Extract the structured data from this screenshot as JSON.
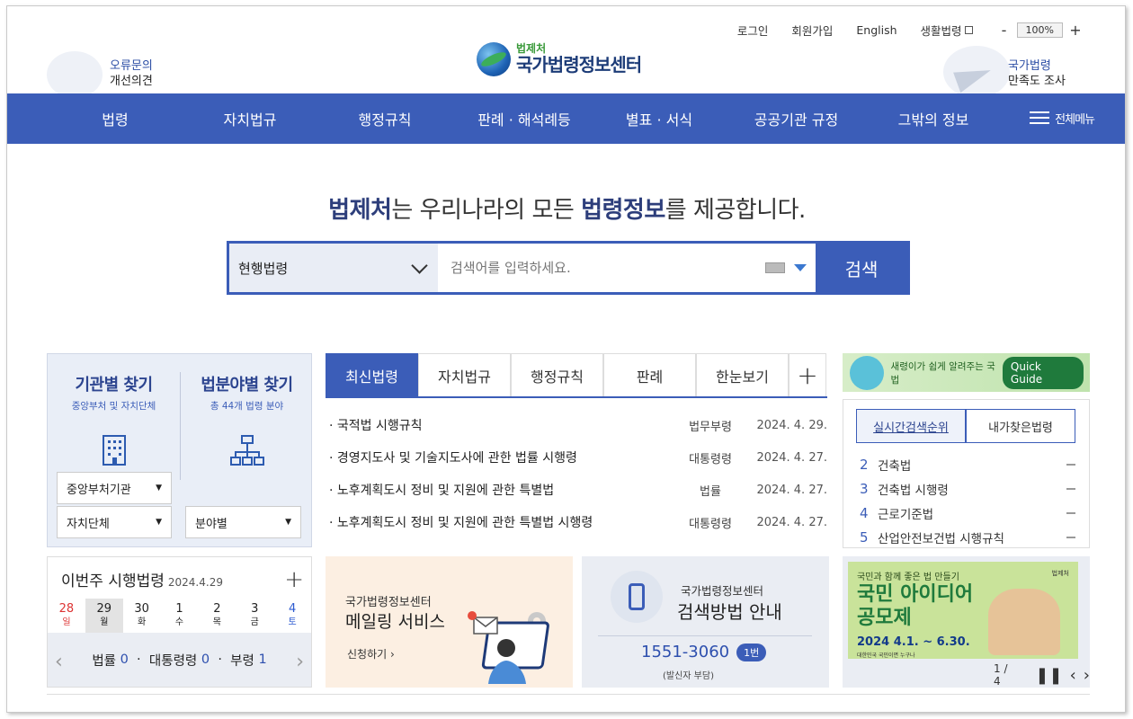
{
  "util": {
    "login": "로그인",
    "signup": "회원가입",
    "english": "English",
    "life_law": "생활법령",
    "zoom_minus": "-",
    "zoom_value": "100%",
    "zoom_plus": "+"
  },
  "left_banner": {
    "line1": "오류문의",
    "line2": "개선의견"
  },
  "logo": {
    "small": "법제처",
    "big": "국가법령정보센터"
  },
  "right_banner": {
    "line1": "국가법령",
    "line2": "만족도 조사"
  },
  "gnb": {
    "items": [
      "법령",
      "자치법규",
      "행정규칙",
      "판례 · 해석례등",
      "별표 · 서식",
      "공공기관 규정",
      "그밖의 정보"
    ],
    "all_menu": "전체메뉴"
  },
  "headline": {
    "p1": "법제처",
    "p2": "는 우리나라의 모든 ",
    "p3": "법령정보",
    "p4": "를 제공합니다."
  },
  "search": {
    "select": "현행법령",
    "placeholder": "검색어를 입력하세요.",
    "button": "검색"
  },
  "finder": {
    "org": {
      "title": "기관별 찾기",
      "sub": "중앙부처 및 자치단체",
      "dd1": "중앙부처기관",
      "dd2": "자치단체"
    },
    "field": {
      "title": "법분야별 찾기",
      "sub": "총 44개 법령 분야",
      "dd1": "분야별"
    }
  },
  "week": {
    "title": "이번주 시행법령",
    "date": "2024.4.29",
    "plus": "+",
    "days": [
      {
        "n": "28",
        "w": "일"
      },
      {
        "n": "29",
        "w": "월"
      },
      {
        "n": "30",
        "w": "화"
      },
      {
        "n": "1",
        "w": "수"
      },
      {
        "n": "2",
        "w": "목"
      },
      {
        "n": "3",
        "w": "금"
      },
      {
        "n": "4",
        "w": "토"
      }
    ],
    "law_label": "법률",
    "law_count": "0",
    "decree_label": "대통령령",
    "decree_count": "0",
    "ordinance_label": "부령",
    "ordinance_count": "1",
    "prev": "‹",
    "next": "›"
  },
  "tabs": {
    "items": [
      "최신법령",
      "자치법규",
      "행정규칙",
      "판례",
      "한눈보기"
    ],
    "more": "+"
  },
  "latest": [
    {
      "title": "· 국적법 시행규칙",
      "kind": "법무부령",
      "date": "2024. 4. 29."
    },
    {
      "title": "· 경영지도사 및 기술지도사에 관한 법률 시행령",
      "kind": "대통령령",
      "date": "2024. 4. 27."
    },
    {
      "title": "· 노후계획도시 정비 및 지원에 관한 특별법",
      "kind": "법률",
      "date": "2024. 4. 27."
    },
    {
      "title": "· 노후계획도시 정비 및 지원에 관한 특별법 시행령",
      "kind": "대통령령",
      "date": "2024. 4. 27."
    }
  ],
  "mail": {
    "line1": "국가법령정보센터",
    "line2": "메일링 서비스",
    "apply": "신청하기 ›"
  },
  "guide": {
    "line1": "국가법령정보센터",
    "line2": "검색방법 안내",
    "phone": "1551-3060",
    "ext": "1번",
    "note": "(발신자 부담)"
  },
  "quick": {
    "text": "새령이가 쉽게 알려주는 국법",
    "button": "Quick Guide"
  },
  "rank": {
    "tab1": "실시간검색순위",
    "tab2": "내가찾은법령",
    "items": [
      {
        "n": "2",
        "name": "건축법"
      },
      {
        "n": "3",
        "name": "건축법 시행령"
      },
      {
        "n": "4",
        "name": "근로기준법"
      },
      {
        "n": "5",
        "name": "산업안전보건법 시행규칙"
      }
    ]
  },
  "idea": {
    "top": "국민과 함께 좋은 법 만들기",
    "title1": "국민 아이디어",
    "title2": "공모제",
    "period": "2024 4.1. ~ 6.30.",
    "org_line": "대한민국 국민이면 누구나",
    "badge": "법제처",
    "pager": "1 / 4"
  },
  "colors": {
    "primary": "#3b5db8",
    "navy": "#2d3e7b",
    "green": "#1f7a3c"
  }
}
